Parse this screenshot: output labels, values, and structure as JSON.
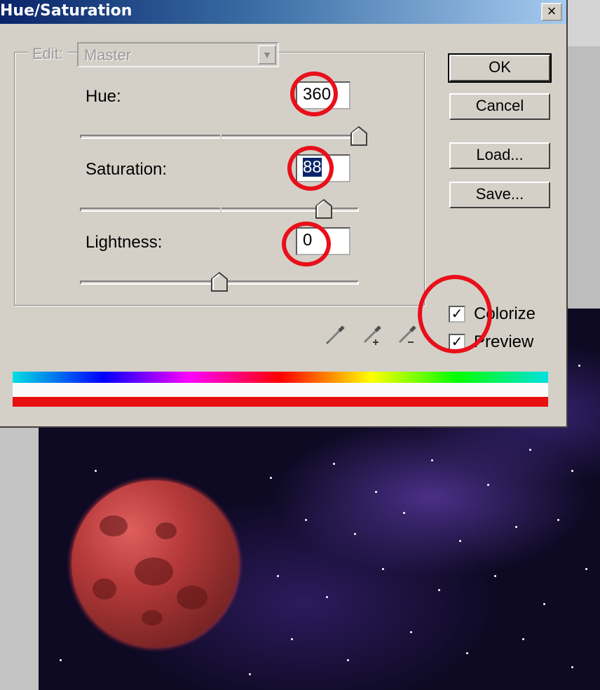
{
  "dialog": {
    "title": "Hue/Saturation",
    "close_symbol": "×",
    "edit_label": "Edit:",
    "edit_selected": "Master",
    "hue": {
      "label": "Hue:",
      "value": "360",
      "slider_fraction": 1.0
    },
    "saturation": {
      "label": "Saturation:",
      "value": "88",
      "slider_fraction": 0.88
    },
    "lightness": {
      "label": "Lightness:",
      "value": "0",
      "slider_fraction": 0.5
    },
    "buttons": {
      "ok": "OK",
      "cancel": "Cancel",
      "load": "Load...",
      "save": "Save..."
    },
    "colorize": {
      "label": "Colorize",
      "checked": true
    },
    "preview": {
      "label": "Preview",
      "checked": true
    },
    "check_mark": "✓"
  },
  "colors": {
    "annotation": "#e8101a",
    "title_bar_start": "#0a246a",
    "dialog_face": "#d4d0c8",
    "colorize_bar": "#e81010"
  },
  "icons": [
    "eyedropper-icon",
    "eyedropper-plus-icon",
    "eyedropper-minus-icon",
    "dropdown-arrow-icon",
    "close-icon"
  ]
}
